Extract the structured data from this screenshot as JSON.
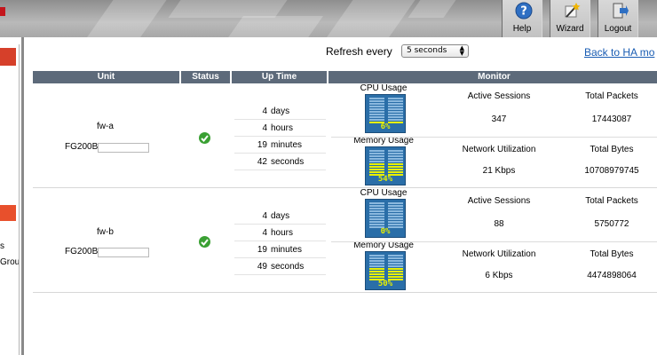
{
  "toolbar": {
    "help_label": "Help",
    "wizard_label": "Wizard",
    "logout_label": "Logout"
  },
  "left_nav": {
    "partial_text_1": "s",
    "partial_text_2": "Grou"
  },
  "main": {
    "refresh_label": "Refresh every",
    "refresh_value": "5 seconds",
    "back_link": "Back to HA mo"
  },
  "table": {
    "headers": {
      "unit": "Unit",
      "status": "Status",
      "uptime": "Up Time",
      "monitor": "Monitor"
    },
    "units": [
      {
        "name": "fw-a",
        "model": "FG200B",
        "status": "ok",
        "uptime": [
          {
            "num": "4",
            "unit": "days"
          },
          {
            "num": "4",
            "unit": "hours"
          },
          {
            "num": "19",
            "unit": "minutes"
          },
          {
            "num": "42",
            "unit": "seconds"
          }
        ],
        "cpu_label": "CPU Usage",
        "cpu_pct_text": "6%",
        "cpu_pct": 6,
        "mem_label": "Memory Usage",
        "mem_pct_text": "54%",
        "mem_pct": 54,
        "active_sessions_label": "Active Sessions",
        "active_sessions": "347",
        "total_packets_label": "Total Packets",
        "total_packets": "17443087",
        "net_util_label": "Network Utilization",
        "net_util": "21 Kbps",
        "total_bytes_label": "Total Bytes",
        "total_bytes": "10708979745"
      },
      {
        "name": "fw-b",
        "model": "FG200B",
        "status": "ok",
        "uptime": [
          {
            "num": "4",
            "unit": "days"
          },
          {
            "num": "4",
            "unit": "hours"
          },
          {
            "num": "19",
            "unit": "minutes"
          },
          {
            "num": "49",
            "unit": "seconds"
          }
        ],
        "cpu_label": "CPU Usage",
        "cpu_pct_text": "0%",
        "cpu_pct": 0,
        "mem_label": "Memory Usage",
        "mem_pct_text": "50%",
        "mem_pct": 50,
        "active_sessions_label": "Active Sessions",
        "active_sessions": "88",
        "total_packets_label": "Total Packets",
        "total_packets": "5750772",
        "net_util_label": "Network Utilization",
        "net_util": "6 Kbps",
        "total_bytes_label": "Total Bytes",
        "total_bytes": "4474898064"
      }
    ]
  },
  "colors": {
    "header_bg": "#5d6a7a",
    "gauge_bg": "#2a6ea8",
    "gauge_fill": "#e8f000",
    "status_ok": "#3aa033",
    "link": "#1a5db3",
    "nav_accent": "#d6402a"
  }
}
